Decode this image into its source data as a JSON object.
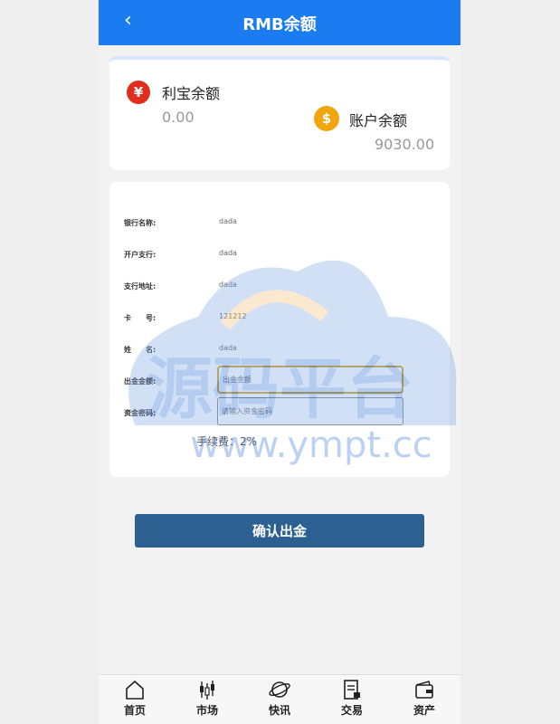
{
  "header": {
    "back_glyph": "‹",
    "title": "RMB余额"
  },
  "balances": {
    "libao": {
      "icon": "yuan-icon",
      "icon_glyph": "¥",
      "label": "利宝余额",
      "value": "0.00"
    },
    "account": {
      "icon": "dollar-icon",
      "icon_glyph": "$",
      "label": "账户余额",
      "value": "9030.00"
    }
  },
  "bank_info": [
    {
      "label": "银行名称:",
      "value": "dada"
    },
    {
      "label": "开户支行:",
      "value": "dada"
    },
    {
      "label": "支行地址:",
      "value": "dada"
    },
    {
      "label": "卡　　号:",
      "value": "121212"
    },
    {
      "label": "姓　　名:",
      "value": "dada"
    }
  ],
  "withdraw": {
    "amount_label": "出金金额:",
    "amount_placeholder": "出金金额",
    "password_label": "资金密码:",
    "password_placeholder": "请输入资金密码",
    "fee_text": "手续费：2%"
  },
  "confirm_label": "确认出金",
  "watermark": {
    "title": "源码平台",
    "url": "www.ympt.cc"
  },
  "tabs": [
    {
      "label": "首页",
      "icon": "home-icon"
    },
    {
      "label": "市场",
      "icon": "market-icon"
    },
    {
      "label": "快讯",
      "icon": "planet-icon"
    },
    {
      "label": "交易",
      "icon": "trade-icon"
    },
    {
      "label": "资产",
      "icon": "wallet-icon"
    }
  ],
  "colors": {
    "header": "#1a7cf0",
    "confirm_button": "#2b6090",
    "yuan_icon": "#e02d1c",
    "dollar_icon": "#f0a70f"
  }
}
